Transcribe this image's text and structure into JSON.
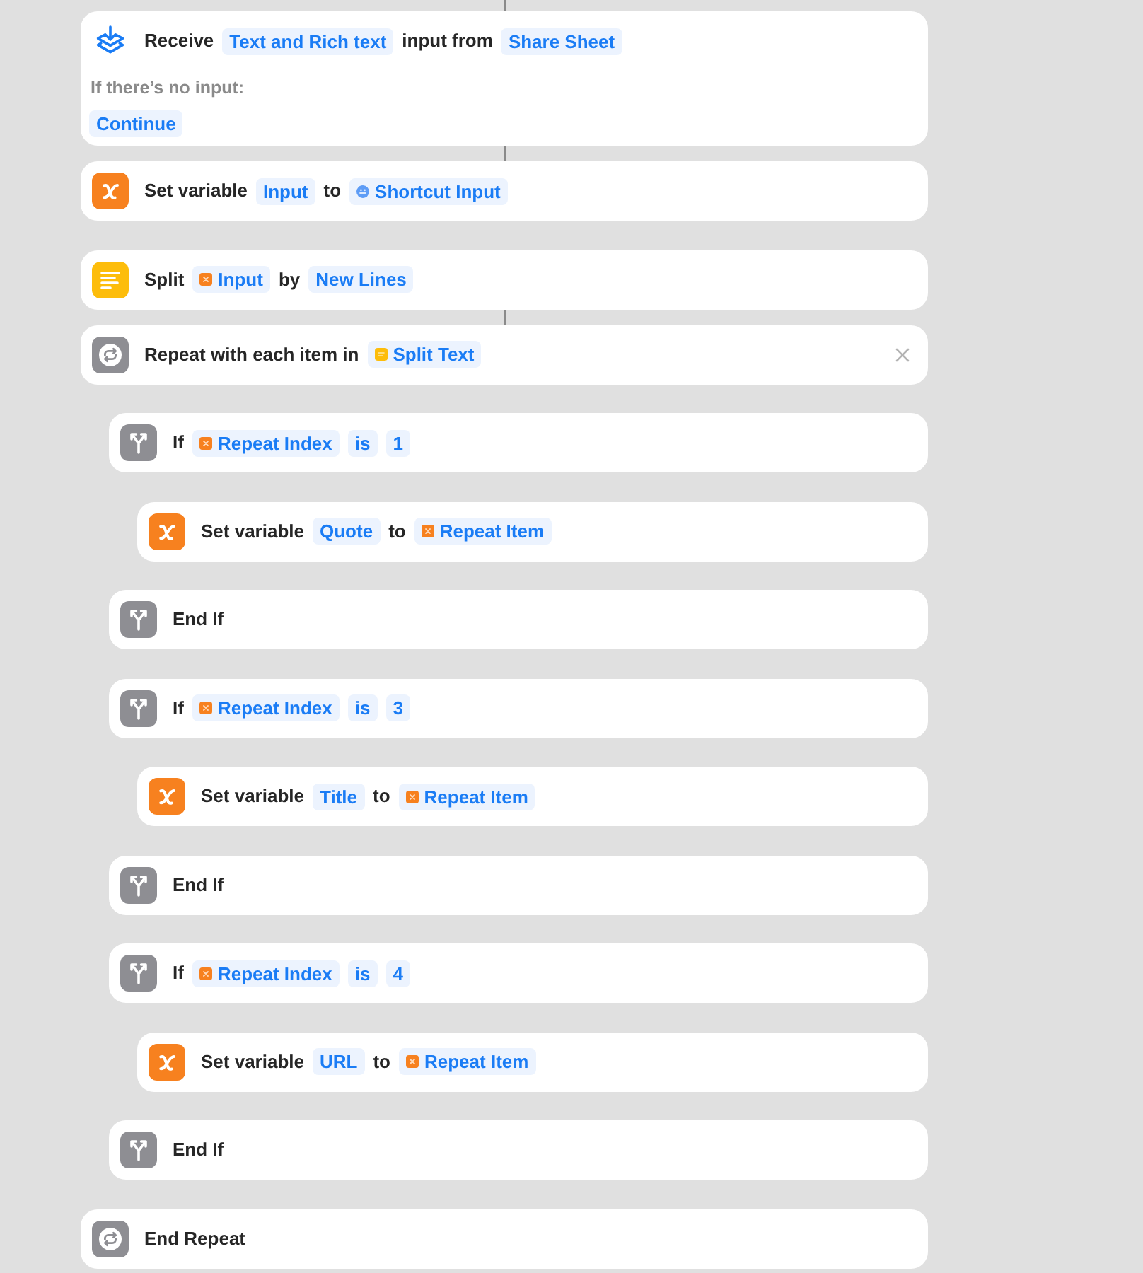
{
  "actions": [
    {
      "kind": "receive",
      "connected": true,
      "hovered": false,
      "parts": [
        {
          "kind": "text",
          "text": "Receive"
        },
        {
          "kind": "token",
          "text": "Text and Rich text"
        },
        {
          "kind": "text",
          "text": "input from"
        },
        {
          "kind": "token",
          "text": "Share Sheet"
        }
      ],
      "fallback": {
        "label": "If there’s no input:",
        "parts": [
          {
            "kind": "token",
            "text": "Continue"
          }
        ]
      }
    },
    {
      "kind": "set_variable",
      "connected": true,
      "hovered": false,
      "parts": [
        {
          "kind": "text",
          "text": "Set variable"
        },
        {
          "kind": "token",
          "text": "Input"
        },
        {
          "kind": "text",
          "text": "to"
        },
        {
          "kind": "shortcut_input",
          "text": "Shortcut Input"
        }
      ]
    },
    {
      "kind": "split",
      "connected": false,
      "hovered": false,
      "parts": [
        {
          "kind": "text",
          "text": "Split"
        },
        {
          "kind": "variable",
          "text": "Input"
        },
        {
          "kind": "text",
          "text": "by"
        },
        {
          "kind": "token",
          "text": "New Lines"
        }
      ]
    },
    {
      "kind": "repeat",
      "connected": true,
      "hovered": true,
      "parts": [
        {
          "kind": "text",
          "text": "Repeat with each item in"
        },
        {
          "kind": "magic_text",
          "text": "Split Text"
        }
      ],
      "children": [
        {
          "kind": "conditional",
          "connected": false,
          "hovered": false,
          "parts": [
            {
              "kind": "text",
              "text": "If"
            },
            {
              "kind": "variable",
              "text": "Repeat Index"
            },
            {
              "kind": "token",
              "text": "is"
            },
            {
              "kind": "token",
              "text": "1"
            }
          ],
          "children": [
            {
              "kind": "set_variable",
              "connected": false,
              "hovered": false,
              "parts": [
                {
                  "kind": "text",
                  "text": "Set variable"
                },
                {
                  "kind": "token",
                  "text": "Quote"
                },
                {
                  "kind": "text",
                  "text": "to"
                },
                {
                  "kind": "variable",
                  "text": "Repeat Item"
                }
              ]
            }
          ]
        },
        {
          "kind": "conditional",
          "connected": false,
          "hovered": false,
          "parts": [
            {
              "kind": "text",
              "text": "End If"
            }
          ]
        },
        {
          "kind": "conditional",
          "connected": false,
          "hovered": false,
          "parts": [
            {
              "kind": "text",
              "text": "If"
            },
            {
              "kind": "variable",
              "text": "Repeat Index"
            },
            {
              "kind": "token",
              "text": "is"
            },
            {
              "kind": "token",
              "text": "3"
            }
          ],
          "children": [
            {
              "kind": "set_variable",
              "connected": false,
              "hovered": false,
              "parts": [
                {
                  "kind": "text",
                  "text": "Set variable"
                },
                {
                  "kind": "token",
                  "text": "Title"
                },
                {
                  "kind": "text",
                  "text": "to"
                },
                {
                  "kind": "variable",
                  "text": "Repeat Item"
                }
              ]
            }
          ]
        },
        {
          "kind": "conditional",
          "connected": false,
          "hovered": false,
          "parts": [
            {
              "kind": "text",
              "text": "End If"
            }
          ]
        },
        {
          "kind": "conditional",
          "connected": false,
          "hovered": false,
          "parts": [
            {
              "kind": "text",
              "text": "If"
            },
            {
              "kind": "variable",
              "text": "Repeat Index"
            },
            {
              "kind": "token",
              "text": "is"
            },
            {
              "kind": "token",
              "text": "4"
            }
          ],
          "children": [
            {
              "kind": "set_variable",
              "connected": false,
              "hovered": false,
              "parts": [
                {
                  "kind": "text",
                  "text": "Set variable"
                },
                {
                  "kind": "token",
                  "text": "URL"
                },
                {
                  "kind": "text",
                  "text": "to"
                },
                {
                  "kind": "variable",
                  "text": "Repeat Item"
                }
              ]
            }
          ]
        },
        {
          "kind": "conditional",
          "connected": false,
          "hovered": false,
          "parts": [
            {
              "kind": "text",
              "text": "End If"
            }
          ]
        }
      ]
    },
    {
      "kind": "repeat",
      "connected": false,
      "hovered": false,
      "parts": [
        {
          "kind": "text",
          "text": "End Repeat"
        }
      ]
    }
  ]
}
